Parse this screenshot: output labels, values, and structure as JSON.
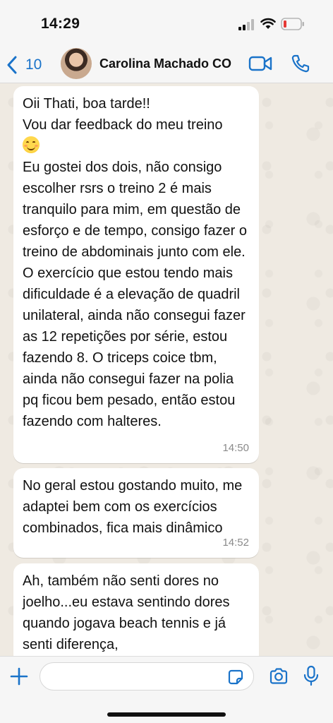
{
  "status_bar": {
    "time": "14:29"
  },
  "header": {
    "back_count": "10",
    "contact_name": "Carolina Machado CO"
  },
  "messages": [
    {
      "text_before_emoji": "Oii Thati, boa tarde!!\nVou dar feedback do meu treino",
      "emoji": "smiling-face-emoji",
      "text_after_emoji": "Eu gostei dos dois, não consigo escolher rsrs o treino 2 é mais tranquilo para mim, em questão de esforço e de tempo, consigo fazer o treino de abdominais junto com ele.\nO exercício que estou tendo mais dificuldade é a elevação de quadril unilateral, ainda não consegui fazer as 12 repetições por série,  estou fazendo 8. O triceps coice tbm, ainda não consegui fazer na polia pq ficou bem pesado, então estou fazendo com halteres.",
      "time": "14:50"
    },
    {
      "text": "No geral estou gostando muito, me adaptei bem com os exercícios combinados, fica mais dinâmico",
      "time": "14:52"
    },
    {
      "text": "Ah, também não senti dores no joelho...eu estava sentindo dores quando jogava beach tennis e já senti diferença,"
    }
  ],
  "input_bar": {
    "message_value": "",
    "placeholder": ""
  },
  "colors": {
    "accent": "#1a73c9",
    "chat_background": "#efeae2",
    "bubble": "#ffffff"
  }
}
